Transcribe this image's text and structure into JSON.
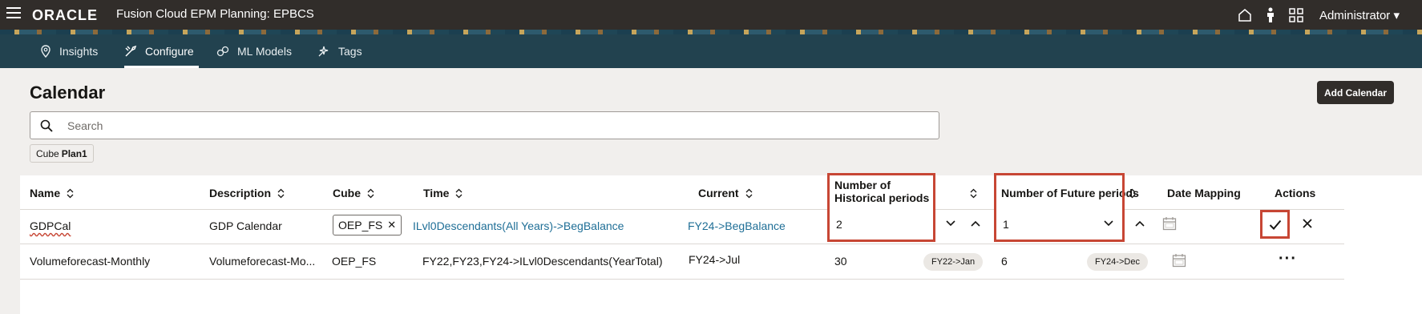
{
  "header": {
    "logo": "ORACLE",
    "app_name": "Fusion Cloud EPM Planning:  EPBCS",
    "user": "Administrator"
  },
  "nav": {
    "tabs": [
      {
        "label": "Insights",
        "icon": "insights-pin-icon"
      },
      {
        "label": "Configure",
        "icon": "configure-tools-icon",
        "active": true
      },
      {
        "label": "ML Models",
        "icon": "ml-models-icon"
      },
      {
        "label": "Tags",
        "icon": "tags-icon"
      }
    ]
  },
  "page": {
    "title": "Calendar",
    "add_button": "Add Calendar",
    "search_placeholder": "Search",
    "filter_chip": {
      "key": "Cube",
      "value": "Plan1"
    }
  },
  "table": {
    "columns": [
      "Name",
      "Description",
      "Cube",
      "Time",
      "Current",
      "Number of Historical periods",
      "Number of Future periods",
      "Date Mapping",
      "Actions"
    ],
    "rows": [
      {
        "name": "GDPCal",
        "description": "GDP Calendar",
        "cube": "OEP_FS",
        "time": "ILvl0Descendants(All Years)->BegBalance",
        "current": "FY24->BegBalance",
        "historical": "2",
        "future": "1",
        "editing": true
      },
      {
        "name": "Volumeforecast-Monthly",
        "description": "Volumeforecast-Mo...",
        "cube": "OEP_FS",
        "time": "FY22,FY23,FY24->ILvl0Descendants(YearTotal)",
        "current": "FY24->Jul",
        "historical": "30",
        "historical_tag": "FY22->Jan",
        "future": "6",
        "future_tag": "FY24->Dec",
        "editing": false
      }
    ]
  },
  "colors": {
    "topbar": "#312d2a",
    "navbar": "#22424f",
    "highlight_box": "#c74634",
    "link": "#1e6e96"
  }
}
